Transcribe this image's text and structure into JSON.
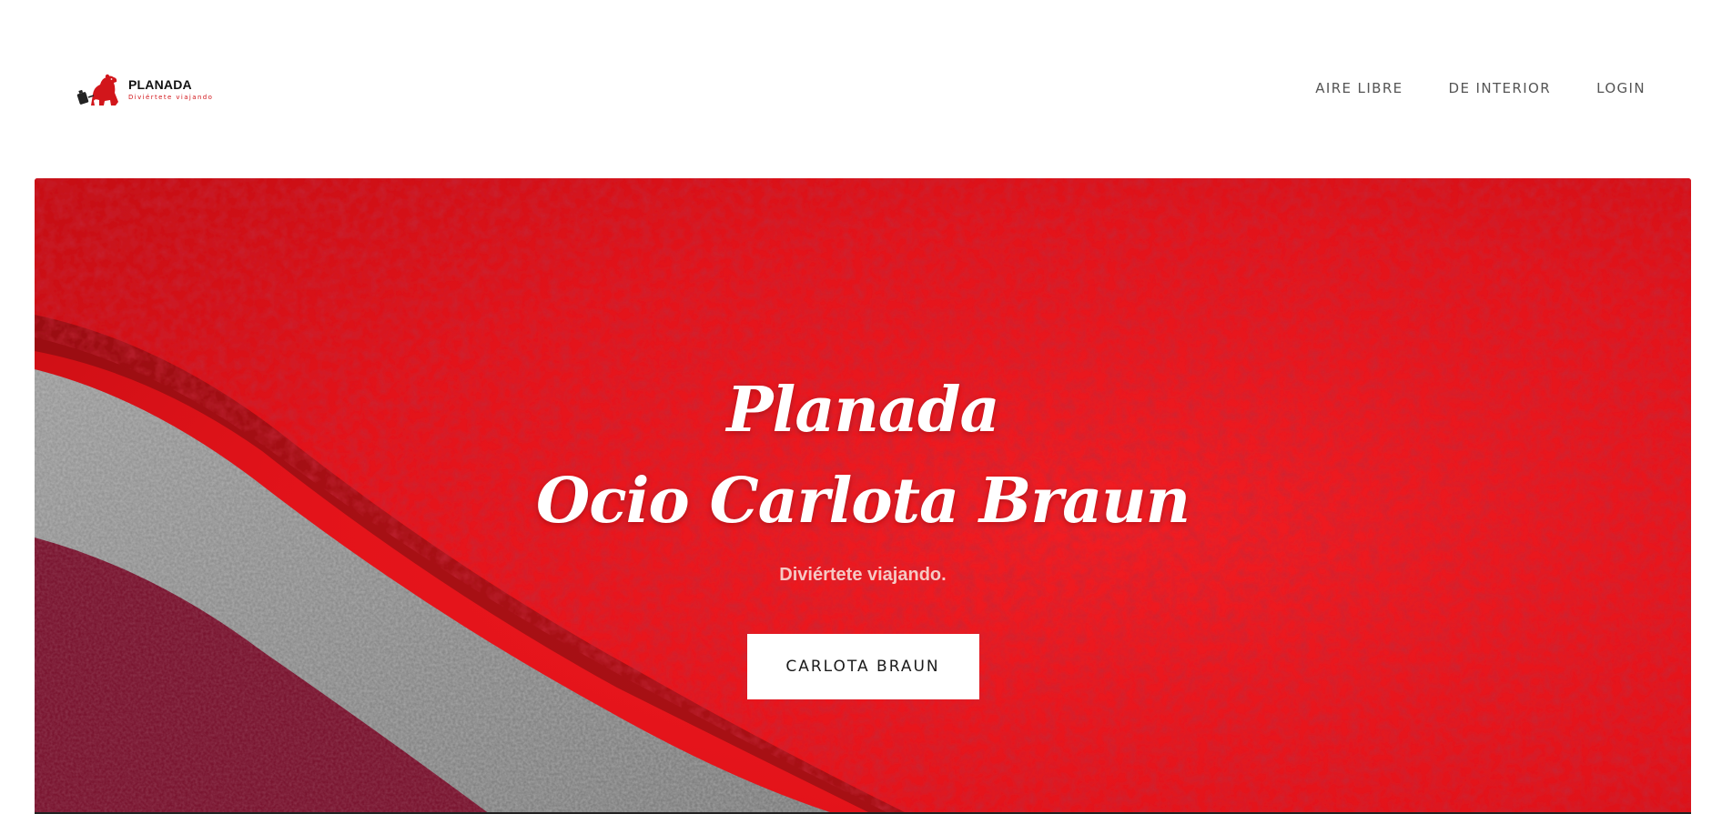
{
  "header": {
    "logo": {
      "name": "PLANADA",
      "tagline": "Diviértete viajando",
      "icon": "bear-suitcase-icon",
      "brand_color": "#d2161b"
    },
    "nav": [
      {
        "label": "AIRE LIBRE"
      },
      {
        "label": "DE INTERIOR"
      },
      {
        "label": "LOGIN"
      }
    ]
  },
  "hero": {
    "title_line1": "Planada",
    "title_line2": "Ocio Carlota Braun",
    "subtitle": "Diviértete viajando.",
    "button_label": "CARLOTA BRAUN",
    "background": "red-carpet-photo",
    "colors": {
      "carpet": "#e8131c",
      "felt_gray": "#8c8c8c",
      "felt_burgundy": "#7a1530"
    }
  }
}
